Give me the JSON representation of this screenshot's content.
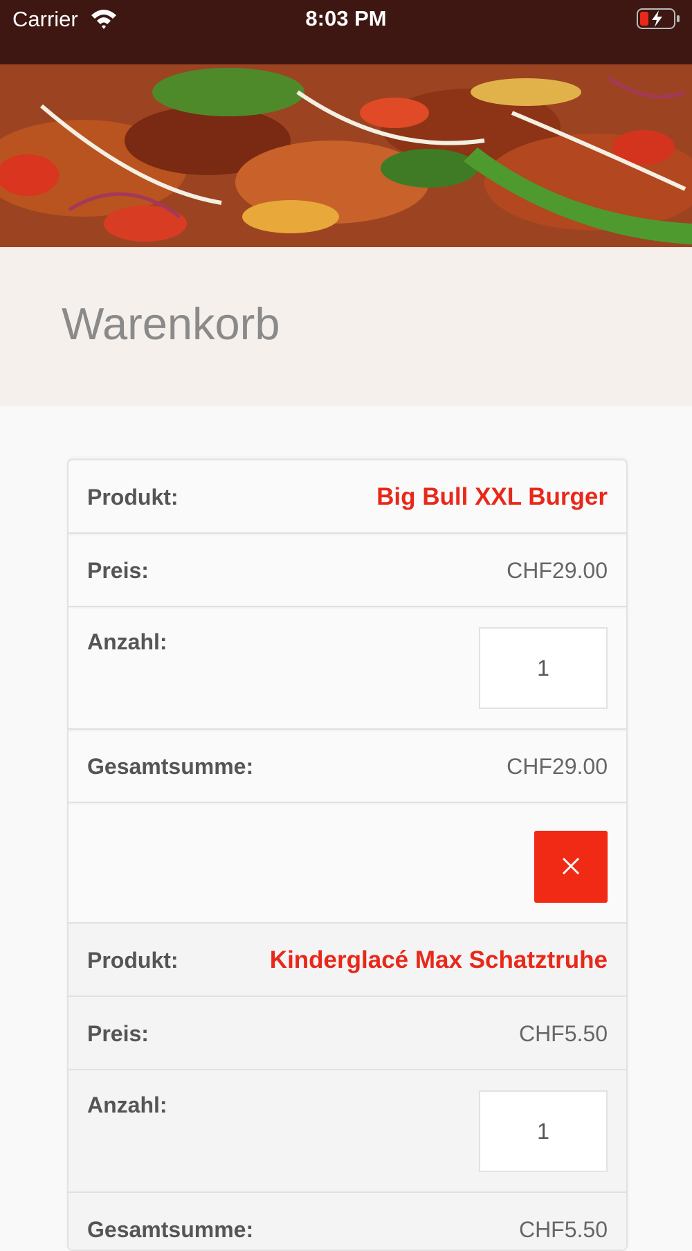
{
  "status_bar": {
    "carrier": "Carrier",
    "time": "8:03 PM",
    "icons": [
      "wifi-icon",
      "battery-charging-icon"
    ]
  },
  "hero": {
    "description_icon": "food-banner-image"
  },
  "page": {
    "title": "Warenkorb"
  },
  "cart": {
    "labels": {
      "product": "Produkt:",
      "price": "Preis:",
      "quantity": "Anzahl:",
      "total": "Gesamtsumme:"
    },
    "items": [
      {
        "product": "Big Bull XXL Burger",
        "price": "CHF29.00",
        "quantity": "1",
        "total": "CHF29.00"
      },
      {
        "product": "Kinderglacé Max Schatztruhe",
        "price": "CHF5.50",
        "quantity": "1",
        "total": "CHF5.50"
      }
    ],
    "delete_icon": "close-icon"
  },
  "colors": {
    "status_bar_bg": "#3e1612",
    "title_band_bg": "#f5f0eb",
    "accent_red": "#f02a14",
    "product_name": "#e8281a"
  }
}
